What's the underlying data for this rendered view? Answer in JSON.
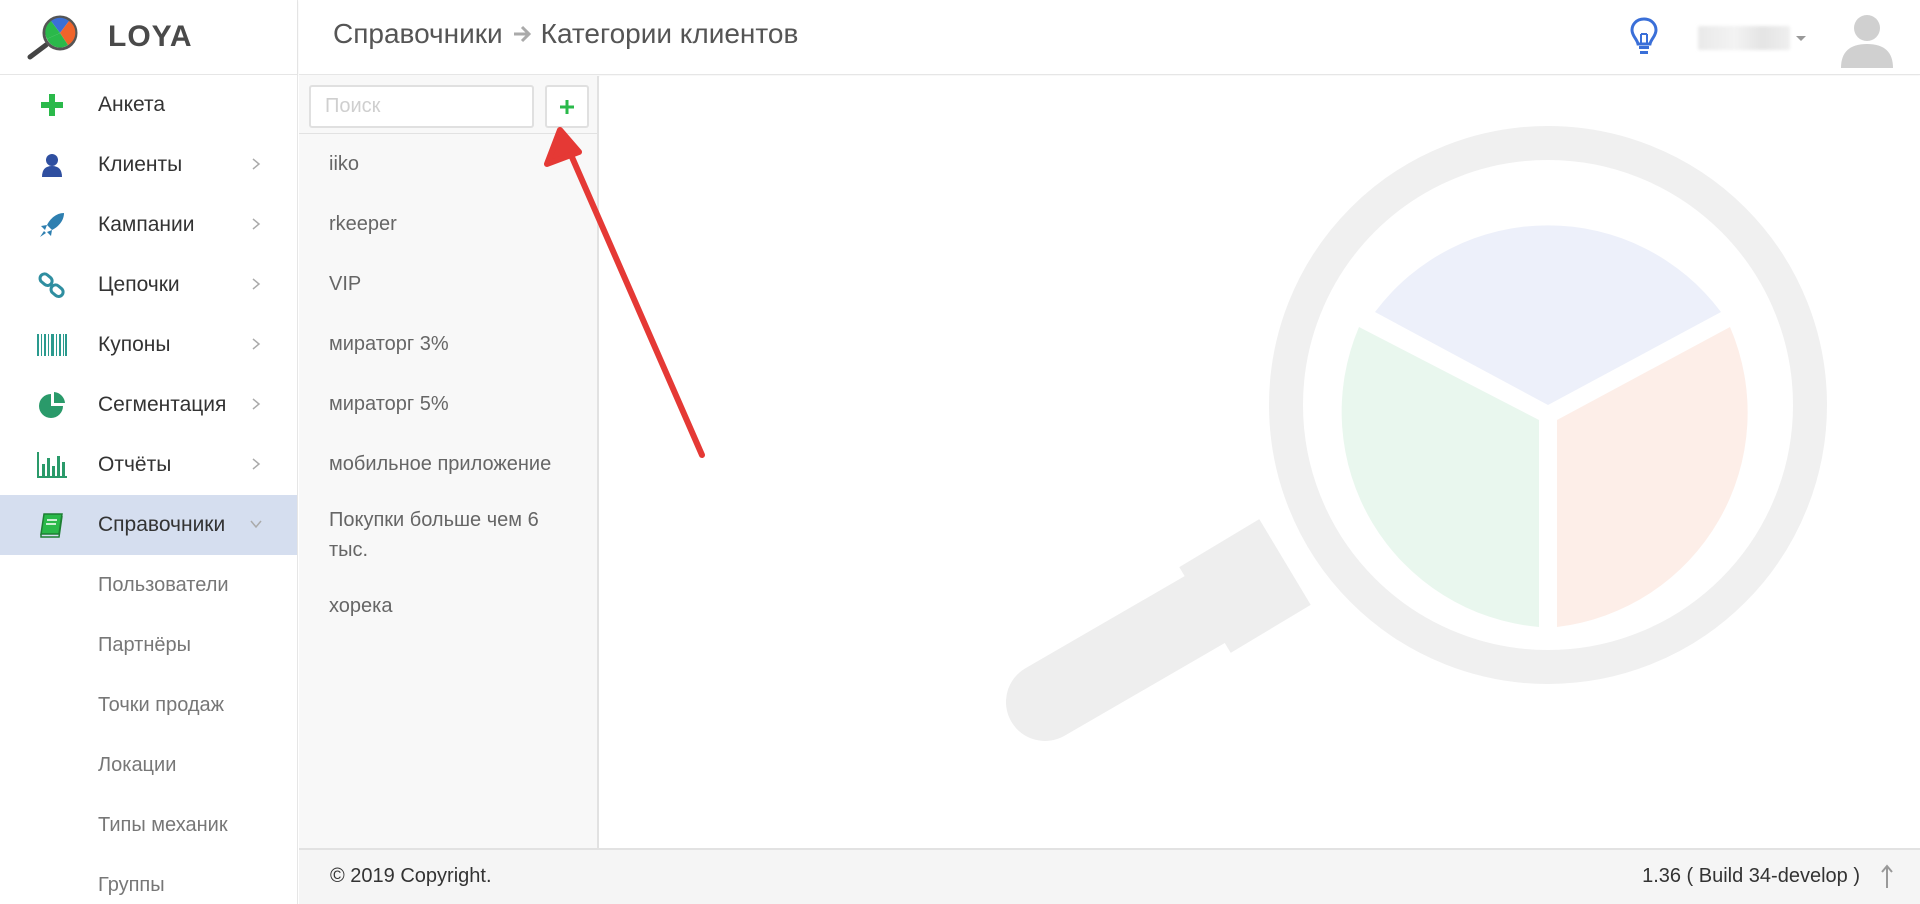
{
  "app": {
    "logo_text": "LOYA"
  },
  "sidebar": {
    "items": [
      {
        "label": "Анкета",
        "icon": "plus-icon",
        "has_chevron": false
      },
      {
        "label": "Клиенты",
        "icon": "user-icon",
        "has_chevron": true
      },
      {
        "label": "Кампании",
        "icon": "rocket-icon",
        "has_chevron": true
      },
      {
        "label": "Цепочки",
        "icon": "chain-link-icon",
        "has_chevron": true
      },
      {
        "label": "Купоны",
        "icon": "barcode-icon",
        "has_chevron": true
      },
      {
        "label": "Сегментация",
        "icon": "pie-chart-icon",
        "has_chevron": true
      },
      {
        "label": "Отчёты",
        "icon": "bar-chart-icon",
        "has_chevron": true
      },
      {
        "label": "Справочники",
        "icon": "book-icon",
        "has_chevron": true,
        "active": true,
        "expanded": true
      }
    ],
    "subitems": [
      {
        "label": "Пользователи"
      },
      {
        "label": "Партнёры"
      },
      {
        "label": "Точки продаж"
      },
      {
        "label": "Локации"
      },
      {
        "label": "Типы механик"
      },
      {
        "label": "Группы"
      }
    ]
  },
  "header": {
    "breadcrumb_parent": "Справочники",
    "breadcrumb_current": "Категории клиентов"
  },
  "list": {
    "search_placeholder": "Поиск",
    "items": [
      {
        "label": "iiko"
      },
      {
        "label": "rkeeper"
      },
      {
        "label": "VIP"
      },
      {
        "label": "мираторг 3%"
      },
      {
        "label": "мираторг 5%"
      },
      {
        "label": "мобильное приложение"
      },
      {
        "label": "Покупки больше чем 6 тыс."
      },
      {
        "label": "хорека"
      }
    ]
  },
  "footer": {
    "copyright": "© 2019 Copyright.",
    "version": "1.36 ( Build 34-develop )"
  },
  "colors": {
    "accent_green": "#2ab94a",
    "active_bg": "#d5deef",
    "annotation_red": "#e53935",
    "bulb_blue": "#3a6fd8"
  }
}
